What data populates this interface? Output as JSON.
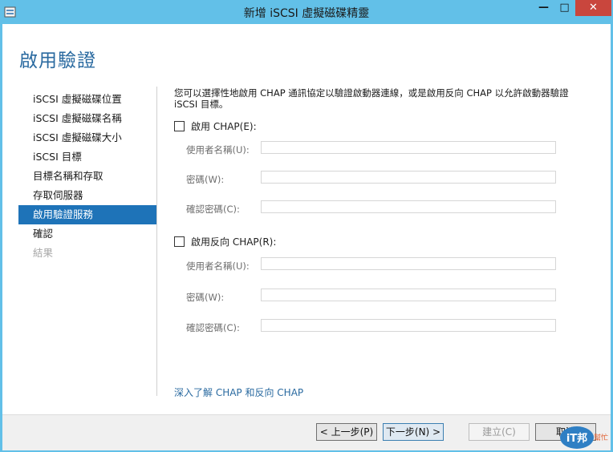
{
  "window": {
    "title": "新增 iSCSI 虛擬磁碟精靈",
    "minimize": "—",
    "maximize": "□",
    "close": "✕"
  },
  "page_title": "啟用驗證",
  "nav": [
    {
      "label": "iSCSI 虛擬磁碟位置",
      "state": "normal"
    },
    {
      "label": "iSCSI 虛擬磁碟名稱",
      "state": "normal"
    },
    {
      "label": "iSCSI 虛擬磁碟大小",
      "state": "normal"
    },
    {
      "label": "iSCSI 目標",
      "state": "normal"
    },
    {
      "label": "目標名稱和存取",
      "state": "normal"
    },
    {
      "label": "存取伺服器",
      "state": "normal"
    },
    {
      "label": "啟用驗證服務",
      "state": "selected"
    },
    {
      "label": "確認",
      "state": "normal"
    },
    {
      "label": "結果",
      "state": "disabled"
    }
  ],
  "description": "您可以選擇性地啟用 CHAP 通訊協定以驗證啟動器連線，或是啟用反向 CHAP 以允許啟動器驗證 iSCSI 目標。",
  "chap": {
    "label": "啟用 CHAP(E):",
    "checked": false,
    "username_label": "使用者名稱(U):",
    "username_value": "",
    "password_label": "密碼(W):",
    "password_value": "",
    "confirm_label": "確認密碼(C):",
    "confirm_value": ""
  },
  "reverse_chap": {
    "label": "啟用反向 CHAP(R):",
    "checked": false,
    "username_label": "使用者名稱(U):",
    "username_value": "",
    "password_label": "密碼(W):",
    "password_value": "",
    "confirm_label": "確認密碼(C):",
    "confirm_value": ""
  },
  "learn_more_link": "深入了解 CHAP 和反向 CHAP",
  "buttons": {
    "prev": "< 上一步(P)",
    "next": "下一步(N) >",
    "create": "建立(C)",
    "cancel": "取消"
  },
  "watermark": {
    "main": "iT邦",
    "sub": "幫忙"
  },
  "colors": {
    "title_bar": "#62c0e8",
    "accent": "#1e73b8",
    "heading": "#2a6aa0",
    "close_button": "#c9463d"
  },
  "icons": [
    "server-wizard-icon",
    "minimize-icon",
    "maximize-icon",
    "close-icon",
    "checkbox-icon"
  ]
}
